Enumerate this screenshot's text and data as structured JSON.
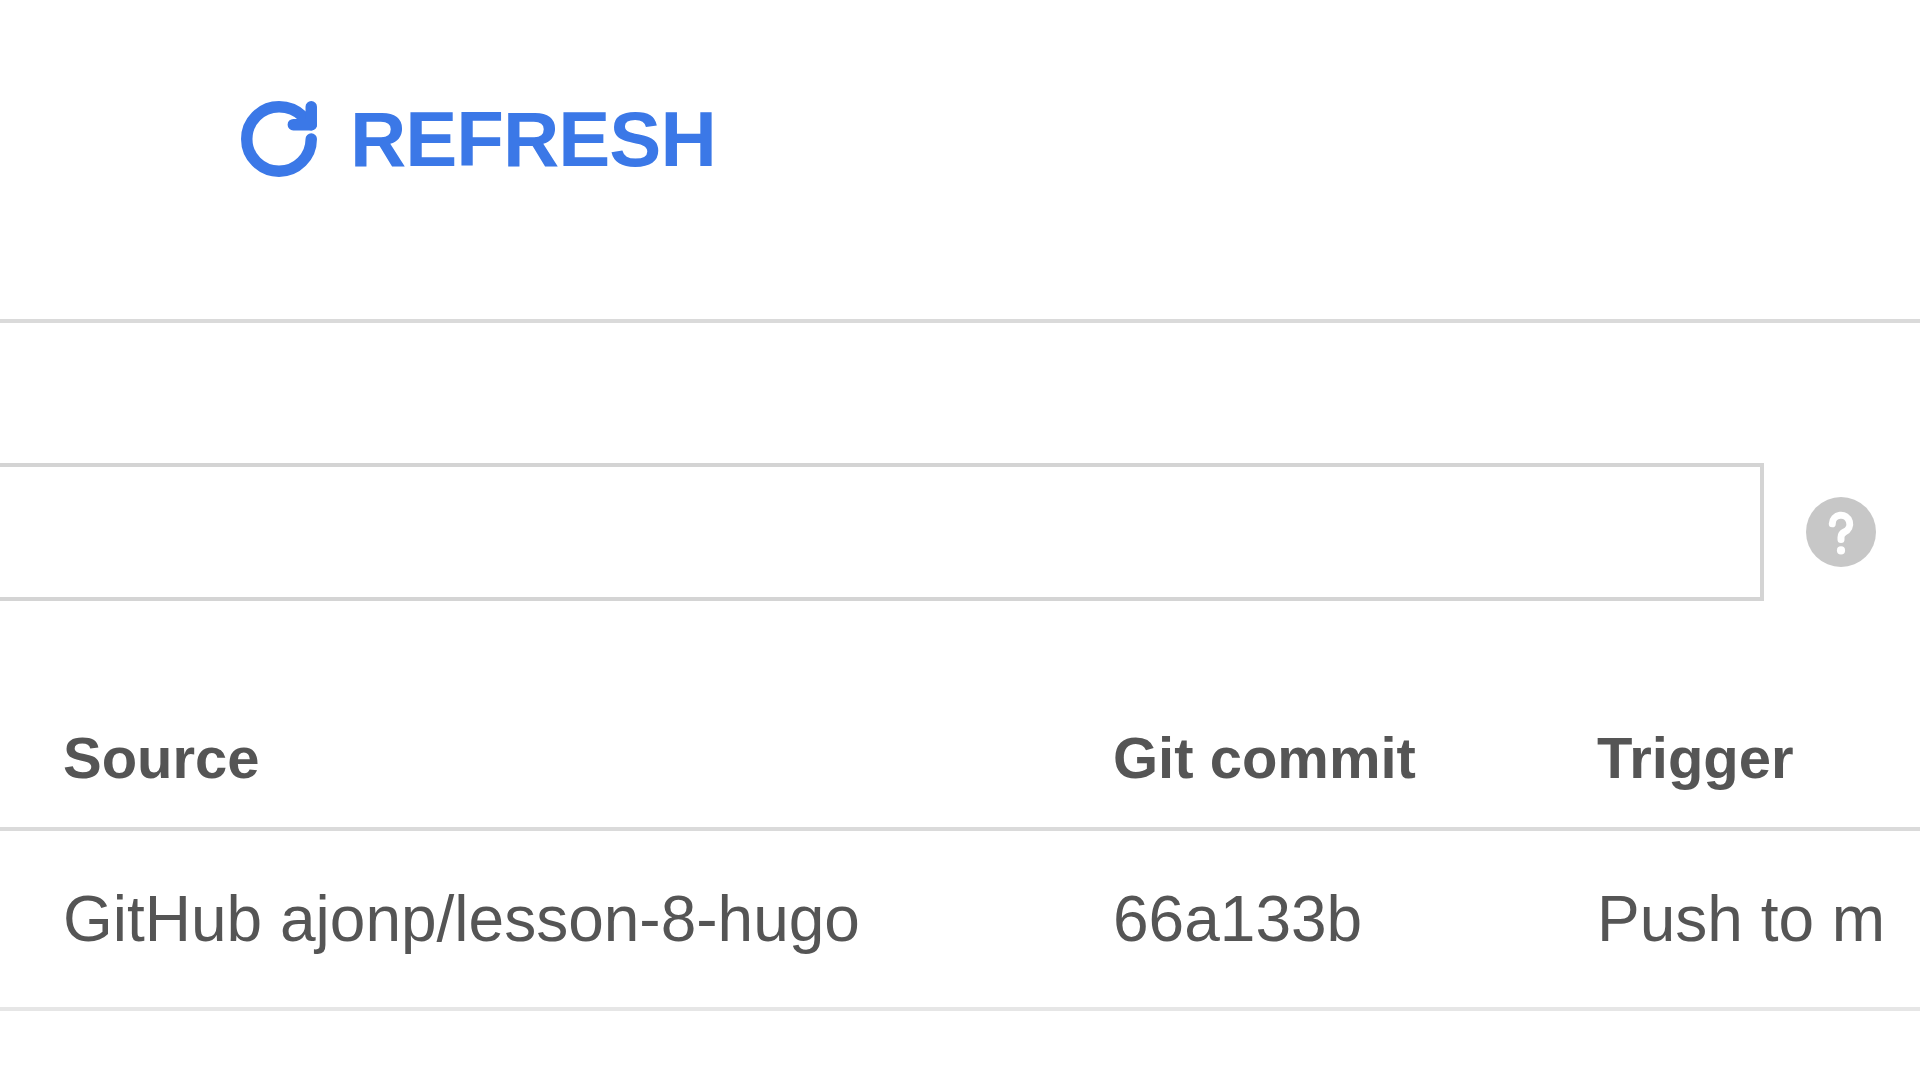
{
  "toolbar": {
    "refresh_button": {
      "label": "REFRESH"
    }
  },
  "table": {
    "columns": [
      "Source",
      "Git commit",
      "Trigger"
    ],
    "rows": [
      [
        "GitHub ajonp/lesson-8-hugo",
        "66a133b",
        "Push to m"
      ]
    ]
  }
}
